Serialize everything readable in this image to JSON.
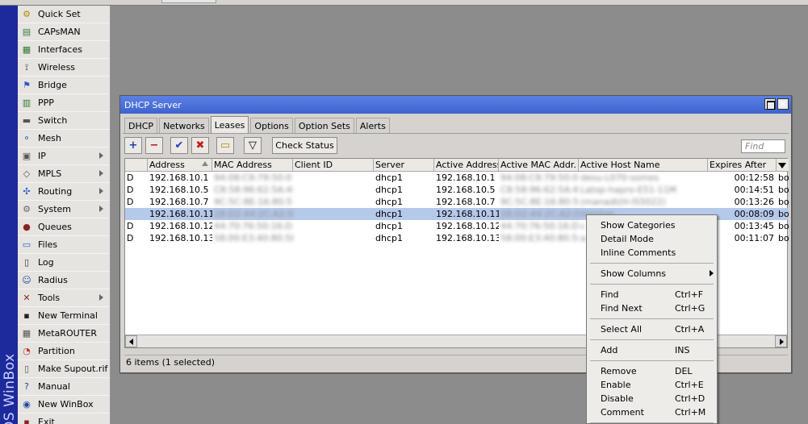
{
  "brand": "OS WinBox",
  "menu": [
    {
      "label": "Quick Set",
      "icon": "quick-set-icon",
      "glyph": "⚙",
      "color": "#b58a00",
      "arrow": false
    },
    {
      "label": "CAPsMAN",
      "icon": "capsman-icon",
      "glyph": "▤",
      "color": "#3a7a3a",
      "arrow": false
    },
    {
      "label": "Interfaces",
      "icon": "interfaces-icon",
      "glyph": "▦",
      "color": "#2f7a2f",
      "arrow": false
    },
    {
      "label": "Wireless",
      "icon": "wireless-icon",
      "glyph": "⟟",
      "color": "#333",
      "arrow": false
    },
    {
      "label": "Bridge",
      "icon": "bridge-icon",
      "glyph": "⚑",
      "color": "#2a5bbf",
      "arrow": false
    },
    {
      "label": "PPP",
      "icon": "ppp-icon",
      "glyph": "▥",
      "color": "#2f7a2f",
      "arrow": false
    },
    {
      "label": "Switch",
      "icon": "switch-icon",
      "glyph": "▬",
      "color": "#555",
      "arrow": false
    },
    {
      "label": "Mesh",
      "icon": "mesh-icon",
      "glyph": "⚬",
      "color": "#1f5fbf",
      "arrow": false
    },
    {
      "label": "IP",
      "icon": "ip-icon",
      "glyph": "▣",
      "color": "#555",
      "arrow": true
    },
    {
      "label": "MPLS",
      "icon": "mpls-icon",
      "glyph": "◇",
      "color": "#555",
      "arrow": true
    },
    {
      "label": "Routing",
      "icon": "routing-icon",
      "glyph": "✣",
      "color": "#2a5bbf",
      "arrow": true
    },
    {
      "label": "System",
      "icon": "system-icon",
      "glyph": "⚙",
      "color": "#666",
      "arrow": true
    },
    {
      "label": "Queues",
      "icon": "queues-icon",
      "glyph": "●",
      "color": "#8b2222",
      "arrow": false
    },
    {
      "label": "Files",
      "icon": "files-icon",
      "glyph": "▭",
      "color": "#2a5bbf",
      "arrow": false
    },
    {
      "label": "Log",
      "icon": "log-icon",
      "glyph": "▯",
      "color": "#333",
      "arrow": false
    },
    {
      "label": "Radius",
      "icon": "radius-icon",
      "glyph": "☺",
      "color": "#1a4aa0",
      "arrow": false
    },
    {
      "label": "Tools",
      "icon": "tools-icon",
      "glyph": "✕",
      "color": "#8b2222",
      "arrow": true
    },
    {
      "label": "New Terminal",
      "icon": "terminal-icon",
      "glyph": "▪",
      "color": "#222",
      "arrow": false
    },
    {
      "label": "MetaROUTER",
      "icon": "metarouter-icon",
      "glyph": "▦",
      "color": "#555",
      "arrow": false
    },
    {
      "label": "Partition",
      "icon": "partition-icon",
      "glyph": "◔",
      "color": "#c0392b",
      "arrow": false
    },
    {
      "label": "Make Supout.rif",
      "icon": "supout-icon",
      "glyph": "▯",
      "color": "#555",
      "arrow": false
    },
    {
      "label": "Manual",
      "icon": "manual-icon",
      "glyph": "?",
      "color": "#1a4aa0",
      "arrow": false
    },
    {
      "label": "New WinBox",
      "icon": "new-winbox-icon",
      "glyph": "◉",
      "color": "#1a4aa0",
      "arrow": false
    },
    {
      "label": "Exit",
      "icon": "exit-icon",
      "glyph": "▪",
      "color": "#8b2222",
      "arrow": false
    }
  ],
  "window": {
    "title": "DHCP Server",
    "tabs": [
      "DHCP",
      "Networks",
      "Leases",
      "Options",
      "Option Sets",
      "Alerts"
    ],
    "active_tab": "Leases",
    "toolbar": {
      "add": "+",
      "remove": "−",
      "enable": "✔",
      "disable": "✖",
      "comment": "▭",
      "filter": "▽",
      "check_status": "Check Status"
    },
    "find_placeholder": "Find",
    "columns": [
      "",
      "Address",
      "MAC Address",
      "Client ID",
      "Server",
      "Active Address",
      "Active MAC Addr.",
      "Active Host Name",
      "Expires After"
    ],
    "rows": [
      {
        "flag": "D",
        "address": "192.168.10.1",
        "mac": "94:08:C9:79:50:07",
        "client_id": "",
        "server": "dhcp1",
        "active_address": "192.168.10.1",
        "active_mac": "94:08:C9:79:50:07",
        "host": "desu-L070-somes",
        "expires": "00:12:58",
        "extra": "bo",
        "selected": false
      },
      {
        "flag": "D",
        "address": "192.168.10.5",
        "mac": "C8:58:96:62:5A:4D",
        "client_id": "",
        "server": "dhcp1",
        "active_address": "192.168.10.5",
        "active_mac": "C8:58:96:62:5A:4D",
        "host": "Latop-hapro-E51-11M",
        "expires": "00:14:51",
        "extra": "bo",
        "selected": false
      },
      {
        "flag": "D",
        "address": "192.168.10.7",
        "mac": "9C:5C:8E:16:80:5F",
        "client_id": "",
        "server": "dhcp1",
        "active_address": "192.168.10.7",
        "active_mac": "9C:5C:8E:16:80:5F",
        "host": "(manadt(H-IS5022)",
        "expires": "00:13:26",
        "extra": "bo",
        "selected": false
      },
      {
        "flag": "",
        "address": "192.168.10.11",
        "mac": "28:D2:44:2C:A2:06",
        "client_id": "",
        "server": "dhcp1",
        "active_address": "192.168.10.11",
        "active_mac": "28:D2:44:2C:A2:06",
        "host": "Halstop",
        "expires": "00:08:09",
        "extra": "bo",
        "selected": true
      },
      {
        "flag": "D",
        "address": "192.168.10.12",
        "mac": "44:70:76:50:16:DF",
        "client_id": "",
        "server": "dhcp1",
        "active_address": "192.168.10.12",
        "active_mac": "44:70:76:50:16:DF",
        "host": "c",
        "expires": "00:13:45",
        "extra": "bo",
        "selected": false
      },
      {
        "flag": "D",
        "address": "192.168.10.13",
        "mac": "58:00:E3:40:80:5F",
        "client_id": "",
        "server": "dhcp1",
        "active_address": "192.168.10.13",
        "active_mac": "58:00:E3:40:80:5F",
        "host": "a",
        "expires": "00:11:07",
        "extra": "bo",
        "selected": false
      }
    ],
    "status": "6 items (1 selected)"
  },
  "context_menu": [
    {
      "label": "Show Categories",
      "shortcut": "",
      "submenu": false,
      "sep_after": false
    },
    {
      "label": "Detail Mode",
      "shortcut": "",
      "submenu": false,
      "sep_after": false
    },
    {
      "label": "Inline Comments",
      "shortcut": "",
      "submenu": false,
      "sep_after": true
    },
    {
      "label": "Show Columns",
      "shortcut": "",
      "submenu": true,
      "sep_after": true
    },
    {
      "label": "Find",
      "shortcut": "Ctrl+F",
      "submenu": false,
      "sep_after": false
    },
    {
      "label": "Find Next",
      "shortcut": "Ctrl+G",
      "submenu": false,
      "sep_after": true
    },
    {
      "label": "Select All",
      "shortcut": "Ctrl+A",
      "submenu": false,
      "sep_after": true
    },
    {
      "label": "Add",
      "shortcut": "INS",
      "submenu": false,
      "sep_after": true
    },
    {
      "label": "Remove",
      "shortcut": "DEL",
      "submenu": false,
      "sep_after": false
    },
    {
      "label": "Enable",
      "shortcut": "Ctrl+E",
      "submenu": false,
      "sep_after": false
    },
    {
      "label": "Disable",
      "shortcut": "Ctrl+D",
      "submenu": false,
      "sep_after": false
    },
    {
      "label": "Comment",
      "shortcut": "Ctrl+M",
      "submenu": false,
      "sep_after": true
    }
  ]
}
